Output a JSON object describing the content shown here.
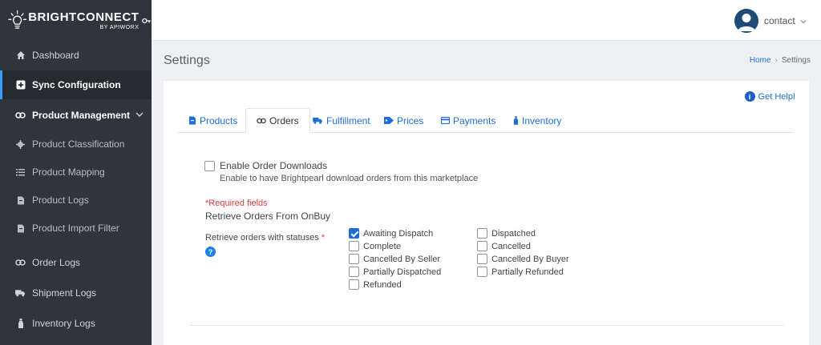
{
  "brand": {
    "name": "BRIGHTCONNECT",
    "by": "BY APIWORX"
  },
  "sidebar": {
    "items": [
      {
        "label": "Dashboard",
        "icon": "home-icon"
      },
      {
        "label": "Sync Configuration",
        "icon": "sync-icon",
        "active": true
      },
      {
        "label": "Product Management",
        "icon": "link-icon",
        "expandable": true
      },
      {
        "label": "Product Classification",
        "icon": "gear-icon"
      },
      {
        "label": "Product Mapping",
        "icon": "list-icon"
      },
      {
        "label": "Product Logs",
        "icon": "file-icon"
      },
      {
        "label": "Product Import Filter",
        "icon": "file-icon"
      },
      {
        "label": "Order Logs",
        "icon": "link-icon"
      },
      {
        "label": "Shipment Logs",
        "icon": "truck-icon"
      },
      {
        "label": "Inventory Logs",
        "icon": "bottle-icon"
      }
    ]
  },
  "topbar": {
    "user": "contact"
  },
  "page": {
    "title": "Settings"
  },
  "breadcrumb": {
    "home": "Home",
    "current": "Settings"
  },
  "help": {
    "label": "Get Help!"
  },
  "tabs": [
    {
      "label": "Products",
      "icon": "document-icon"
    },
    {
      "label": "Orders",
      "icon": "link-icon",
      "active": true
    },
    {
      "label": "Fulfillment",
      "icon": "truck-icon"
    },
    {
      "label": "Prices",
      "icon": "tag-icon"
    },
    {
      "label": "Payments",
      "icon": "card-icon"
    },
    {
      "label": "Inventory",
      "icon": "bottle-icon"
    }
  ],
  "orders": {
    "enable_label": "Enable Order Downloads",
    "enable_desc": "Enable to have Brightpearl download orders from this marketplace",
    "enable_checked": false,
    "required_note": "*Required fields",
    "section_title": "Retrieve Orders From OnBuy",
    "statuses_label": "Retrieve orders with statuses",
    "statuses_required_mark": "*",
    "help_mark": "?",
    "statuses": [
      {
        "label": "Awaiting Dispatch",
        "checked": true
      },
      {
        "label": "Complete",
        "checked": false
      },
      {
        "label": "Cancelled By Seller",
        "checked": false
      },
      {
        "label": "Partially Dispatched",
        "checked": false
      },
      {
        "label": "Refunded",
        "checked": false
      },
      {
        "label": "Dispatched",
        "checked": false
      },
      {
        "label": "Cancelled",
        "checked": false
      },
      {
        "label": "Cancelled By Buyer",
        "checked": false
      },
      {
        "label": "Partially Refunded",
        "checked": false
      }
    ]
  },
  "colors": {
    "sidebar": "#2f353c",
    "accent": "#1d6fd6",
    "required": "#e03b3b"
  }
}
